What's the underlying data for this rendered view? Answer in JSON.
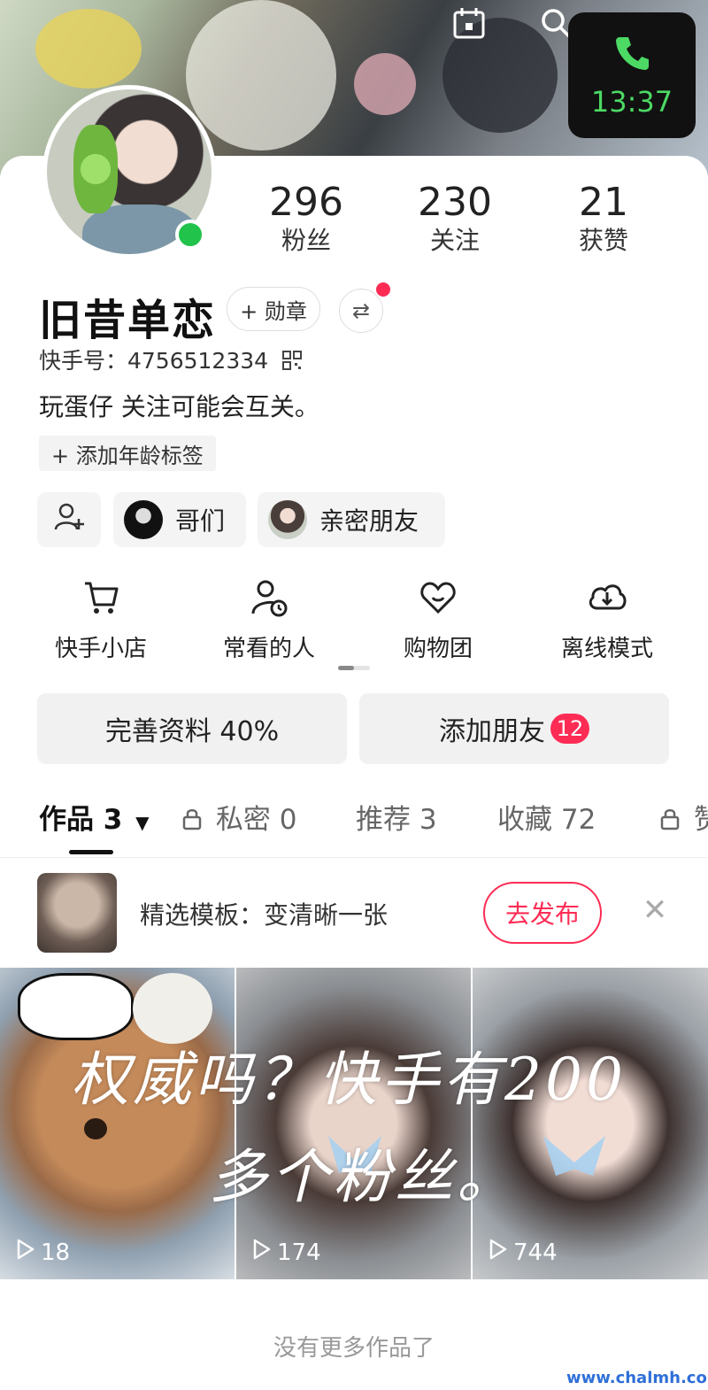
{
  "call": {
    "time": "13:37"
  },
  "profile": {
    "name": "旧昔单恋",
    "medal_label": "+ 勋章",
    "uid": "快手号：4756512334",
    "bio": "玩蛋仔 关注可能会互关。",
    "age_tag": "+ 添加年龄标签"
  },
  "stats": [
    {
      "num": "296",
      "label": "粉丝"
    },
    {
      "num": "230",
      "label": "关注"
    },
    {
      "num": "21",
      "label": "获赞"
    }
  ],
  "chips": [
    {
      "label": "哥们"
    },
    {
      "label": "亲密朋友"
    }
  ],
  "features": [
    {
      "label": "快手小店",
      "icon": "cart-icon"
    },
    {
      "label": "常看的人",
      "icon": "user-clock-icon"
    },
    {
      "label": "购物团",
      "icon": "heart-bag-icon"
    },
    {
      "label": "离线模式",
      "icon": "cloud-download-icon"
    }
  ],
  "actions": {
    "complete_profile": "完善资料 40%",
    "add_friends": "添加朋友",
    "add_friends_count": "12"
  },
  "tabs": [
    {
      "label": "作品 3"
    },
    {
      "label": "私密 0"
    },
    {
      "label": "推荐 3"
    },
    {
      "label": "收藏 72"
    },
    {
      "label": "赞"
    }
  ],
  "promo": {
    "text": "精选模板：变清晰一张",
    "button": "去发布"
  },
  "videos": [
    {
      "plays": "18"
    },
    {
      "plays": "174"
    },
    {
      "plays": "744"
    }
  ],
  "overlay": {
    "line1": "权威吗？快手有200",
    "line2": "多个粉丝。"
  },
  "footer": {
    "end_text": "没有更多作品了",
    "watermark": "www.chalmh.com"
  }
}
